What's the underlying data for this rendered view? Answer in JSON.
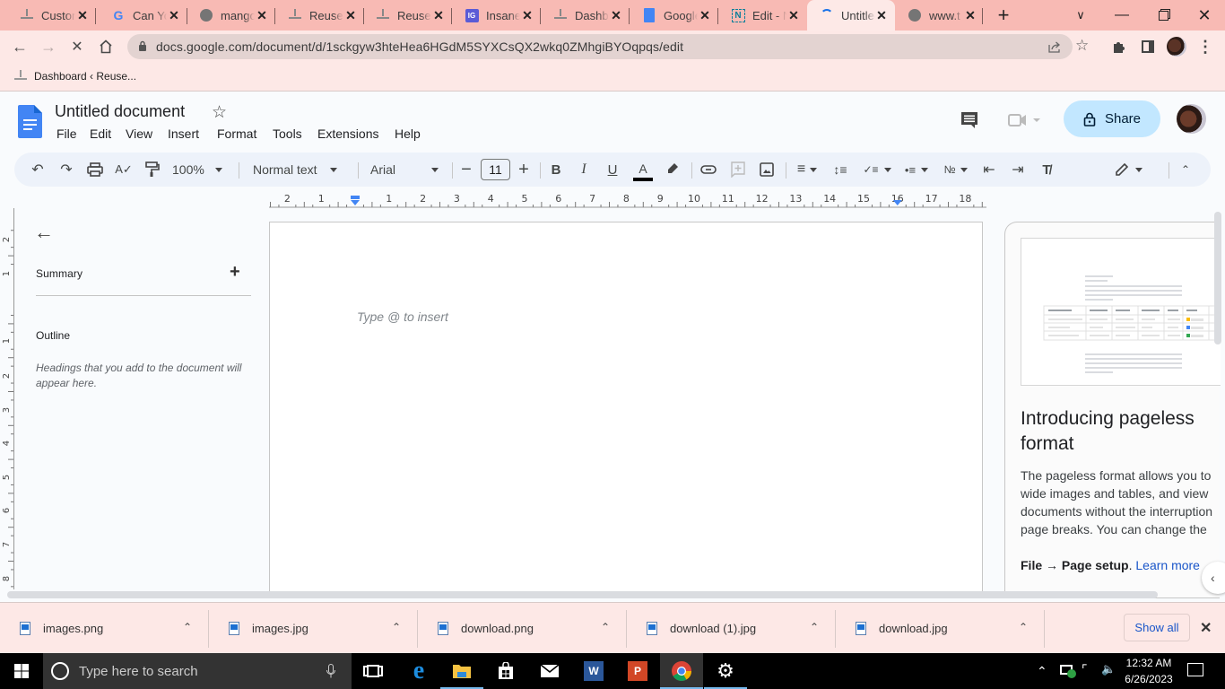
{
  "browser": {
    "tabs": [
      {
        "title": "Custom",
        "icon": "reuse-favicon"
      },
      {
        "title": "Can You",
        "icon": "google-icon"
      },
      {
        "title": "mango",
        "icon": "globe-icon"
      },
      {
        "title": "Reuse",
        "icon": "reuse-favicon"
      },
      {
        "title": "Reuse",
        "icon": "reuse-favicon"
      },
      {
        "title": "Insane",
        "icon": "ig-icon"
      },
      {
        "title": "Dashb",
        "icon": "reuse-favicon"
      },
      {
        "title": "Google",
        "icon": "docs-icon"
      },
      {
        "title": "Edit - N",
        "icon": "notion-icon"
      },
      {
        "title": "Untitled",
        "icon": "loading-icon",
        "active": true
      },
      {
        "title": "www.t",
        "icon": "globe-icon"
      }
    ],
    "new_tab_label": "+",
    "url": "docs.google.com/document/d/1sckgyw3hteHea6HGdM5SYXCsQX2wkq0ZMhgiBYOqpqs/edit",
    "bookmarks": [
      {
        "label": "Dashboard ‹ Reuse..."
      }
    ]
  },
  "docs": {
    "title": "Untitled document",
    "menu": [
      "File",
      "Edit",
      "View",
      "Insert",
      "Format",
      "Tools",
      "Extensions",
      "Help"
    ],
    "share_label": "Share",
    "toolbar": {
      "zoom": "100%",
      "style": "Normal text",
      "font": "Arial",
      "font_size": "11"
    },
    "ruler_h": [
      "2",
      "1",
      "1",
      "2",
      "3",
      "4",
      "5",
      "6",
      "7",
      "8",
      "9",
      "10",
      "11",
      "12",
      "13",
      "14",
      "15",
      "16",
      "17",
      "18"
    ],
    "ruler_v": [
      "2",
      "1",
      "1",
      "2",
      "3",
      "4",
      "5",
      "6",
      "7",
      "8"
    ],
    "outline_panel": {
      "summary_label": "Summary",
      "outline_label": "Outline",
      "outline_hint": "Headings that you add to the document will appear here."
    },
    "page_placeholder": "Type @ to insert",
    "pageless_promo": {
      "title": "Introducing pageless format",
      "body": "The pageless format allows you to wide images and tables, and view documents without the interruption page breaks. You can change the format for any of your documents",
      "path_bold": "File → Page setup",
      "link": "Learn more"
    }
  },
  "downloads": {
    "items": [
      "images.png",
      "images.jpg",
      "download.png",
      "download (1).jpg",
      "download.jpg"
    ],
    "show_all_label": "Show all"
  },
  "taskbar": {
    "search_placeholder": "Type here to search",
    "time": "12:32 AM",
    "date": "6/26/2023"
  },
  "colors": {
    "tab_strip": "#f8bab4",
    "share_bg": "#c2e7ff",
    "link": "#1a56c9",
    "docs_blue": "#4285f4"
  }
}
